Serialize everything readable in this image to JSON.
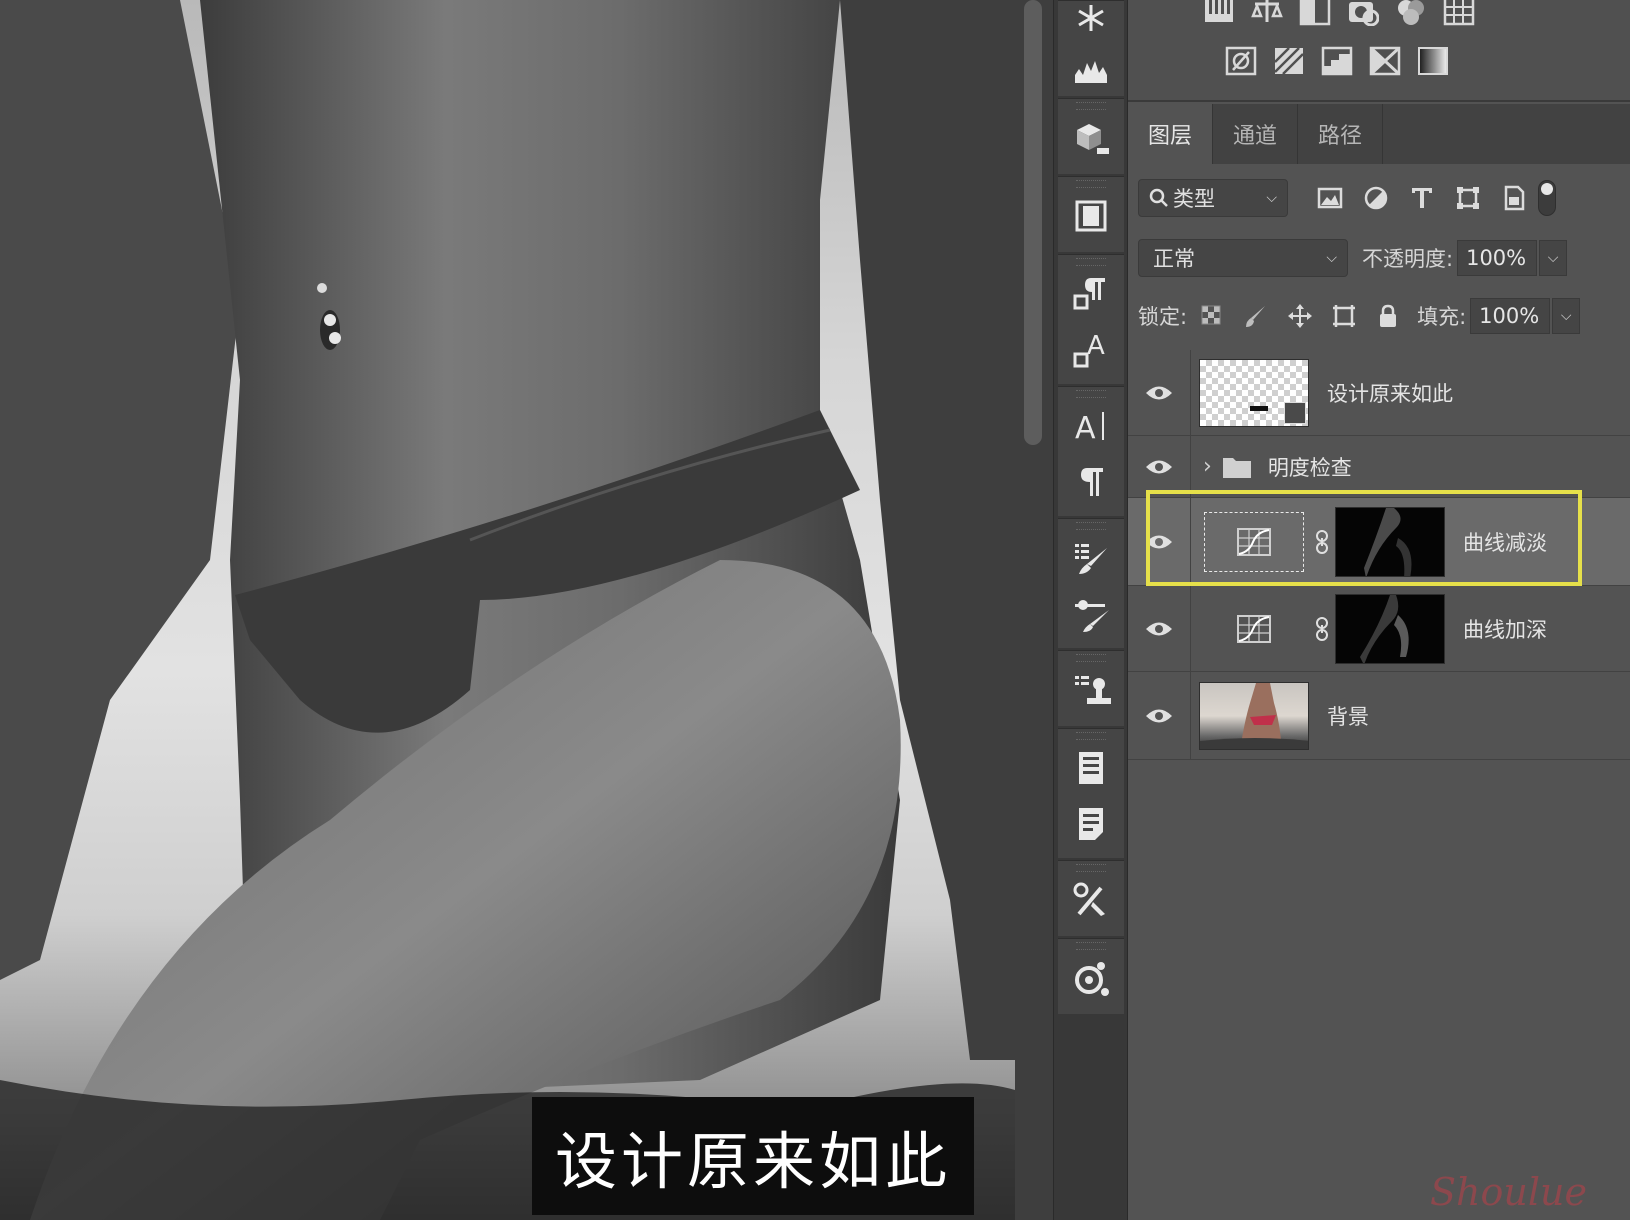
{
  "canvas": {
    "caption": "设计原来如此"
  },
  "adjustments_panel": {
    "row1_icons": [
      "brightness-icon",
      "levels-icon",
      "curves-icon",
      "exposure-icon",
      "vibrance-icon",
      "hue-icon"
    ],
    "row2_icons": [
      "invert-icon",
      "posterize-icon",
      "threshold-icon",
      "selective-color-icon",
      "gradient-map-icon"
    ]
  },
  "tool_strip": {
    "icons": [
      "asterisk-icon",
      "histogram-icon",
      "3d-icon",
      "frame-icon",
      "paragraph-style-icon",
      "character-style-icon",
      "character-icon",
      "paragraph-icon",
      "brush-preset-icon",
      "brush-settings-icon",
      "clone-source-icon",
      "properties-icon",
      "notes-icon",
      "tool-presets-icon",
      "modifier-icon"
    ]
  },
  "layers_panel": {
    "tabs": [
      {
        "label": "图层",
        "active": true
      },
      {
        "label": "通道",
        "active": false
      },
      {
        "label": "路径",
        "active": false
      }
    ],
    "filter": {
      "label": "类型"
    },
    "blend_mode": "正常",
    "opacity_label": "不透明度:",
    "opacity_value": "100%",
    "lock_label": "锁定:",
    "fill_label": "填充:",
    "fill_value": "100%",
    "layers": [
      {
        "name": "设计原来如此",
        "type": "smart-object"
      },
      {
        "name": "明度检查",
        "type": "group"
      },
      {
        "name": "曲线减淡",
        "type": "curves-adjustment",
        "selected": true
      },
      {
        "name": "曲线加深",
        "type": "curves-adjustment"
      },
      {
        "name": "背景",
        "type": "image"
      }
    ]
  },
  "colors": {
    "highlight_border": "#e6e04a",
    "panel_bg": "#535353"
  },
  "watermark": "Shoulue"
}
